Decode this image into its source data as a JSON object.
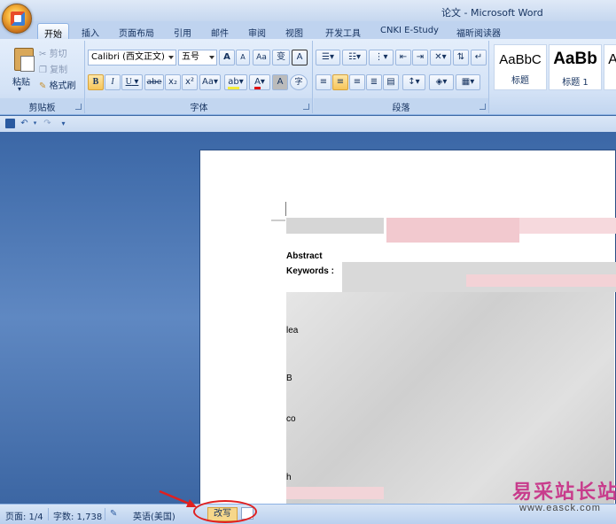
{
  "window": {
    "title": "论文 - Microsoft Word"
  },
  "tabs": [
    {
      "label": "开始",
      "active": true
    },
    {
      "label": "插入"
    },
    {
      "label": "页面布局"
    },
    {
      "label": "引用"
    },
    {
      "label": "邮件"
    },
    {
      "label": "审阅"
    },
    {
      "label": "视图"
    },
    {
      "label": "开发工具"
    },
    {
      "label": "CNKI E-Study"
    },
    {
      "label": "福昕阅读器"
    }
  ],
  "clipboard": {
    "label": "剪贴板",
    "paste": "粘贴",
    "cut": "剪切",
    "copy": "复制",
    "format_painter": "格式刷"
  },
  "font": {
    "label": "字体",
    "font_name": "Calibri (西文正文)",
    "font_size": "五号",
    "grow": "A",
    "shrink": "A",
    "clear": "Aa",
    "phonetic": "变",
    "border_char": "A",
    "bold": "B",
    "italic": "I",
    "underline": "U",
    "strike": "abe",
    "subscript": "x₂",
    "superscript": "x²",
    "change_case": "Aa",
    "highlight": "ab",
    "font_color": "A",
    "shading": "A",
    "enclose": "字"
  },
  "paragraph": {
    "label": "段落"
  },
  "styles": {
    "items": [
      {
        "sample": "AaBbC",
        "name": "标题"
      },
      {
        "sample": "AaBb",
        "name": "标题 1"
      },
      {
        "sample": "Aa",
        "name": ""
      }
    ]
  },
  "document": {
    "abstract": "Abstract",
    "keywords": "Keywords :",
    "frag_lea": "lea",
    "frag_b": "B",
    "frag_co": "co",
    "frag_h": "h"
  },
  "status": {
    "page": "页面: 1/4",
    "words": "字数: 1,738",
    "language": "英语(美国)",
    "overtype": "改写"
  },
  "watermark": {
    "cn": "易采站长站",
    "url": "www.easck.com"
  },
  "colors": {
    "accent": "#c2d6f0",
    "highlight": "#f6d78a",
    "annotation": "#e02020"
  }
}
